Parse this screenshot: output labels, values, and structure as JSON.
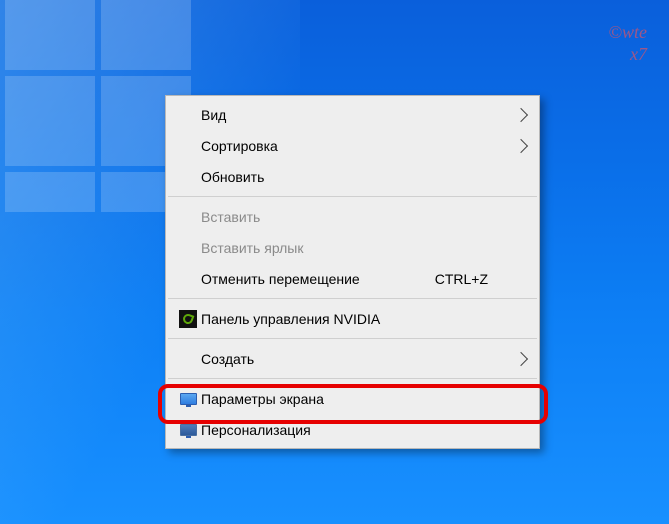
{
  "menu": {
    "view": "Вид",
    "sort": "Сортировка",
    "refresh": "Обновить",
    "paste": "Вставить",
    "paste_shortcut": "Вставить ярлык",
    "undo_move": "Отменить перемещение",
    "undo_move_shortcut": "CTRL+Z",
    "nvidia_panel": "Панель управления NVIDIA",
    "create": "Создать",
    "display_settings": "Параметры экрана",
    "personalize": "Персонализация"
  }
}
